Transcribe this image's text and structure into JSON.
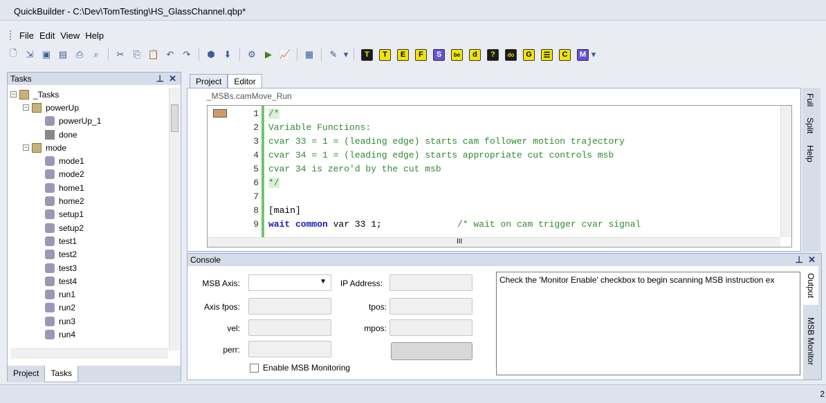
{
  "window": {
    "title": "QuickBuilder - C:\\Dev\\TomTesting\\HS_GlassChannel.qbp*"
  },
  "menu": [
    "File",
    "Edit",
    "View",
    "Help"
  ],
  "toolbar_letters": [
    {
      "t": "T",
      "c": "bl"
    },
    {
      "t": "T",
      "c": "yb"
    },
    {
      "t": "E",
      "c": "yb"
    },
    {
      "t": "F",
      "c": "yb"
    },
    {
      "t": "S",
      "c": "pu"
    },
    {
      "t": "be",
      "c": "yb"
    },
    {
      "t": "d",
      "c": "yb"
    },
    {
      "t": "?",
      "c": "bl"
    },
    {
      "t": "do",
      "c": "bl"
    },
    {
      "t": "G",
      "c": "yb"
    },
    {
      "t": "☰",
      "c": "yb"
    },
    {
      "t": "C",
      "c": "yb"
    },
    {
      "t": "M",
      "c": "pu"
    }
  ],
  "tasks_panel": {
    "title": "Tasks",
    "pin": "⊥",
    "close": "✕"
  },
  "tree": [
    {
      "label": "_Tasks",
      "level": 0,
      "icon": "folder",
      "exp": "−"
    },
    {
      "label": "powerUp",
      "level": 1,
      "icon": "folder",
      "exp": "−"
    },
    {
      "label": "powerUp_1",
      "level": 2,
      "icon": "msb"
    },
    {
      "label": "done",
      "level": 2,
      "icon": "done"
    },
    {
      "label": "mode",
      "level": 1,
      "icon": "folder",
      "exp": "−"
    },
    {
      "label": "mode1",
      "level": 2,
      "icon": "msb"
    },
    {
      "label": "mode2",
      "level": 2,
      "icon": "msb"
    },
    {
      "label": "home1",
      "level": 2,
      "icon": "msb"
    },
    {
      "label": "home2",
      "level": 2,
      "icon": "msb"
    },
    {
      "label": "setup1",
      "level": 2,
      "icon": "msb"
    },
    {
      "label": "setup2",
      "level": 2,
      "icon": "msb"
    },
    {
      "label": "test1",
      "level": 2,
      "icon": "msb"
    },
    {
      "label": "test2",
      "level": 2,
      "icon": "msb"
    },
    {
      "label": "test3",
      "level": 2,
      "icon": "msb"
    },
    {
      "label": "test4",
      "level": 2,
      "icon": "msb"
    },
    {
      "label": "run1",
      "level": 2,
      "icon": "msb"
    },
    {
      "label": "run2",
      "level": 2,
      "icon": "msb"
    },
    {
      "label": "run3",
      "level": 2,
      "icon": "msb"
    },
    {
      "label": "run4",
      "level": 2,
      "icon": "msb"
    }
  ],
  "left_tabs": {
    "project": "Project",
    "tasks": "Tasks"
  },
  "main_tabs": {
    "project": "Project",
    "editor": "Editor"
  },
  "editor": {
    "file_tab": "_MSBs.camMove_Run",
    "line_numbers": [
      "1",
      "2",
      "3",
      "4",
      "5",
      "6",
      "7",
      "8",
      "9"
    ],
    "lines": [
      "/*",
      "Variable Functions:",
      "cvar 33 = 1 = (leading edge) starts cam follower motion trajectory",
      "cvar 34 = 1 = (leading edge) starts appropriate cut controls msb",
      "cvar 34 is zero'd by the cut msb",
      "*/",
      "",
      "[main]",
      "wait common var 33 1;              /* wait on cam trigger cvar signal"
    ],
    "hscroll_thumb": "III"
  },
  "right_tabs": [
    "Full",
    "Split",
    "Help"
  ],
  "console": {
    "title": "Console",
    "msb_axis_label": "MSB Axis:",
    "ip_label": "IP Address:",
    "axis_fpos_label": "Axis fpos:",
    "tpos_label": "tpos:",
    "vel_label": "vel:",
    "mpos_label": "mpos:",
    "perr_label": "perr:",
    "enable_label": "Enable MSB Monitoring",
    "output_text": "Check the 'Monitor Enable' checkbox to begin scanning MSB instruction ex",
    "side_tabs": [
      "Output",
      "MSB Monitor"
    ]
  },
  "statusbar": {
    "right": "2"
  }
}
